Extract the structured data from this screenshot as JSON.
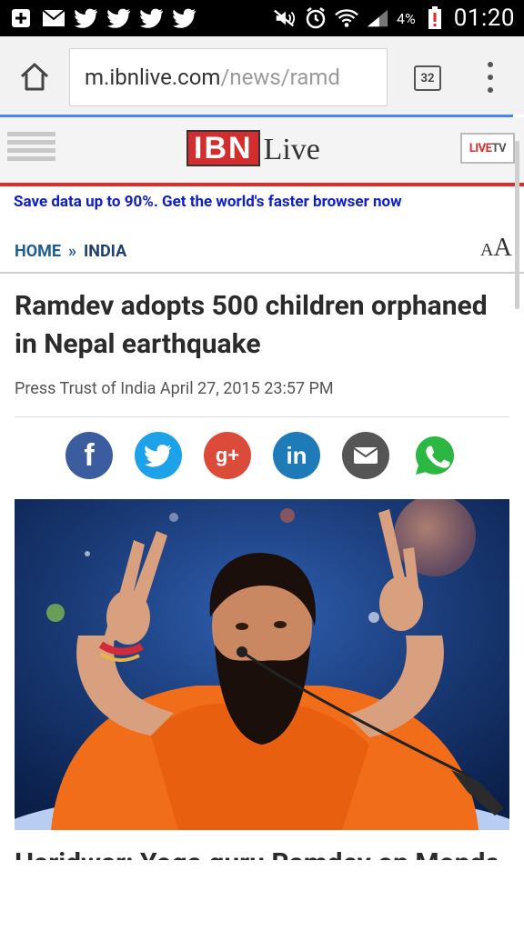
{
  "status_bar": {
    "battery": "4%",
    "time": "01:20",
    "icons": [
      "plus-icon",
      "mail-icon",
      "twitter-icon",
      "twitter-icon",
      "twitter-icon",
      "twitter-icon",
      "mute-icon",
      "alarm-icon",
      "wifi-icon",
      "signal-icon",
      "battery-icon"
    ]
  },
  "browser": {
    "url_host": "m.ibnlive.com",
    "url_path": "/news/ramd",
    "tab_count": "32"
  },
  "site": {
    "logo_ibn": "IBN",
    "logo_live": "Live",
    "livetv_live": "LIVE",
    "livetv_tv": "TV"
  },
  "promo": "Save data up to 90%. Get the world's faster browser now",
  "breadcrumb": {
    "home": "HOME",
    "sep": "»",
    "category": "INDIA"
  },
  "article": {
    "headline": "Ramdev adopts 500 children orphaned in Nepal earthquake",
    "byline": "Press Trust of India April 27, 2015 23:57 PM",
    "cut_text": "Haridwar: Yoga guru Ramdev on Monday"
  },
  "share": [
    "facebook",
    "twitter",
    "google-plus",
    "linkedin",
    "email",
    "whatsapp"
  ],
  "share_glyphs": {
    "facebook": "f",
    "google_plus": "g+",
    "linkedin": "in"
  },
  "colors": {
    "accent_red": "#e02b2b",
    "link_blue": "#1f5e91",
    "promo_blue": "#1020c0"
  }
}
